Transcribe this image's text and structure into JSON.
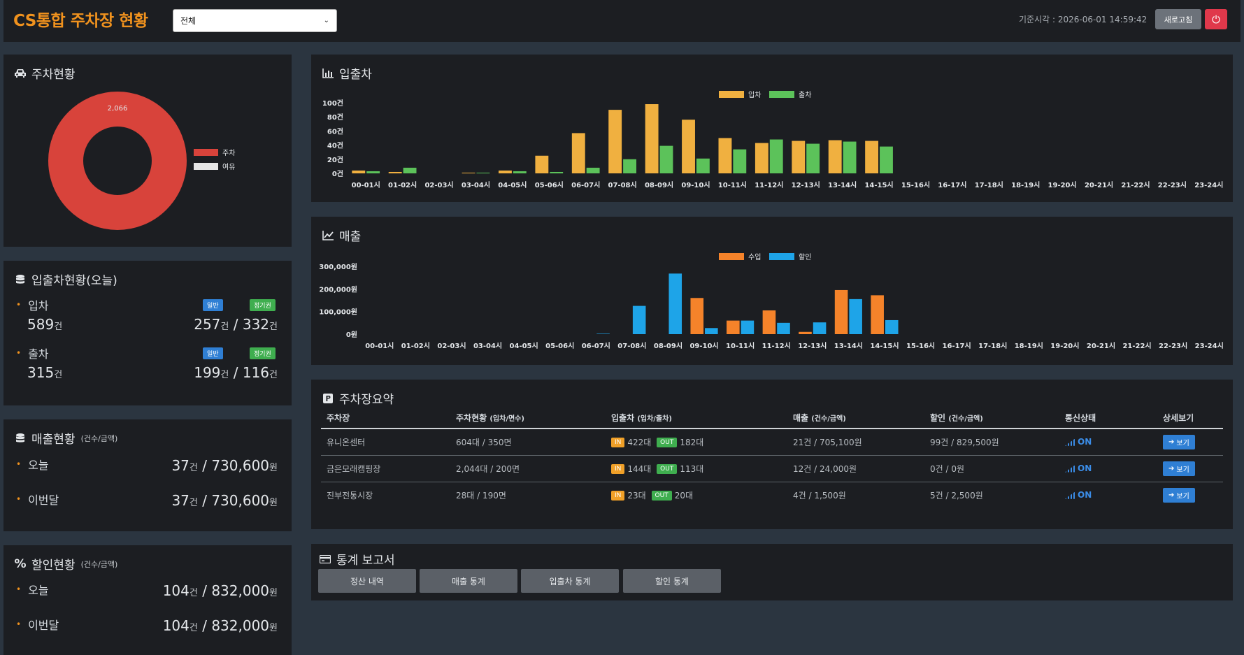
{
  "header": {
    "title": "CS통합 주차장 현황",
    "filter_value": "전체",
    "base_time": "기준시각 : 2026-06-01 14:59:42",
    "refresh_label": "새로고침",
    "power_icon": "power-icon"
  },
  "parking_status": {
    "title": "주차현황",
    "icon": "car-icon",
    "donut_label": "2,066",
    "legend": [
      {
        "label": "주차",
        "color": "#d8433b"
      },
      {
        "label": "여유",
        "color": "#e6e6e6"
      }
    ],
    "occupied_fraction": 1.0
  },
  "inout_today": {
    "title": "입출차현황(오늘)",
    "icon": "database-icon",
    "badge_general": "일반",
    "badge_season": "정기권",
    "entry": {
      "label": "입차",
      "total": "589",
      "unit": "건",
      "general": "257",
      "season": "332"
    },
    "exit": {
      "label": "출차",
      "total": "315",
      "unit": "건",
      "general": "199",
      "season": "116"
    },
    "separator": "/"
  },
  "sales_status": {
    "title": "매출현황",
    "sub": "(건수/금액)",
    "icon": "database-icon",
    "today": {
      "label": "오늘",
      "count": "37",
      "count_unit": "건",
      "amount": "730,600",
      "amount_unit": "원"
    },
    "month": {
      "label": "이번달",
      "count": "37",
      "count_unit": "건",
      "amount": "730,600",
      "amount_unit": "원"
    }
  },
  "discount_status": {
    "title": "할인현황",
    "sub": "(건수/금액)",
    "icon": "percent-icon",
    "today": {
      "label": "오늘",
      "count": "104",
      "count_unit": "건",
      "amount": "832,000",
      "amount_unit": "원"
    },
    "month": {
      "label": "이번달",
      "count": "104",
      "count_unit": "건",
      "amount": "832,000",
      "amount_unit": "원"
    }
  },
  "chart_inout_panel": {
    "title": "입출차",
    "icon": "bar-chart-icon"
  },
  "chart_sales_panel": {
    "title": "매출",
    "icon": "line-chart-icon"
  },
  "chart_data": [
    {
      "type": "bar",
      "title": "입출차",
      "categories": [
        "00-01시",
        "01-02시",
        "02-03시",
        "03-04시",
        "04-05시",
        "05-06시",
        "06-07시",
        "07-08시",
        "08-09시",
        "09-10시",
        "10-11시",
        "11-12시",
        "12-13시",
        "13-14시",
        "14-15시",
        "15-16시",
        "16-17시",
        "17-18시",
        "18-19시",
        "19-20시",
        "20-21시",
        "21-22시",
        "22-23시",
        "23-24시"
      ],
      "y_ticks": [
        "0건",
        "20건",
        "40건",
        "60건",
        "80건",
        "100건"
      ],
      "ylim": [
        0,
        100
      ],
      "legend_position": "top-center",
      "series": [
        {
          "name": "입차",
          "color": "#f0b040",
          "values": [
            4,
            2,
            0,
            1,
            4,
            25,
            57,
            90,
            98,
            76,
            50,
            43,
            46,
            47,
            46,
            0,
            0,
            0,
            0,
            0,
            0,
            0,
            0,
            0
          ]
        },
        {
          "name": "출차",
          "color": "#5cc25a",
          "values": [
            3,
            8,
            0,
            1,
            3,
            2,
            8,
            20,
            39,
            21,
            34,
            48,
            42,
            45,
            38,
            0,
            0,
            0,
            0,
            0,
            0,
            0,
            0,
            0
          ]
        }
      ]
    },
    {
      "type": "bar",
      "title": "매출",
      "categories": [
        "00-01시",
        "01-02시",
        "02-03시",
        "03-04시",
        "04-05시",
        "05-06시",
        "06-07시",
        "07-08시",
        "08-09시",
        "09-10시",
        "10-11시",
        "11-12시",
        "12-13시",
        "13-14시",
        "14-15시",
        "15-16시",
        "16-17시",
        "17-18시",
        "18-19시",
        "19-20시",
        "20-21시",
        "21-22시",
        "22-23시",
        "23-24시"
      ],
      "y_ticks": [
        "0원",
        "100,000원",
        "200,000원",
        "300,000원"
      ],
      "ylim": [
        0,
        300000
      ],
      "legend_position": "top-center",
      "series": [
        {
          "name": "수입",
          "color": "#f5832a",
          "values": [
            0,
            0,
            0,
            0,
            0,
            0,
            0,
            0,
            0,
            160000,
            60000,
            105000,
            10000,
            195000,
            172000,
            0,
            0,
            0,
            0,
            0,
            0,
            0,
            0,
            0
          ]
        },
        {
          "name": "할인",
          "color": "#1ea4e8",
          "values": [
            0,
            0,
            0,
            0,
            0,
            0,
            2000,
            125000,
            268000,
            27000,
            60000,
            50000,
            52000,
            155000,
            62000,
            0,
            0,
            0,
            0,
            0,
            0,
            0,
            0,
            0
          ]
        }
      ]
    }
  ],
  "summary": {
    "title": "주차장요약",
    "icon": "parking-icon",
    "headers": [
      "주차장",
      "주차현황",
      "(입차/면수)",
      "입출차",
      "(입차/출차)",
      "매출",
      "(건수/금액)",
      "할인",
      "(건수/금액)",
      "통신상태",
      "상세보기"
    ],
    "in_tag": "IN",
    "out_tag": "OUT",
    "view_label": "보기",
    "rows": [
      {
        "name": "유니온센터",
        "status": "604대 / 350면",
        "in": "422대",
        "out": "182대",
        "sales": "21건 / 705,100원",
        "discount": "99건 / 829,500원",
        "comm": "ON"
      },
      {
        "name": "금은모래캠핑장",
        "status": "2,044대 / 200면",
        "in": "144대",
        "out": "113대",
        "sales": "12건 / 24,000원",
        "discount": "0건 / 0원",
        "comm": "ON"
      },
      {
        "name": "진부전통시장",
        "status": "28대 / 190면",
        "in": "23대",
        "out": "20대",
        "sales": "4건 / 1,500원",
        "discount": "5건 / 2,500원",
        "comm": "ON"
      }
    ]
  },
  "reports": {
    "title": "통계 보고서",
    "icon": "report-icon",
    "buttons": [
      "정산 내역",
      "매출 통계",
      "입출차 통계",
      "할인 통계"
    ]
  }
}
